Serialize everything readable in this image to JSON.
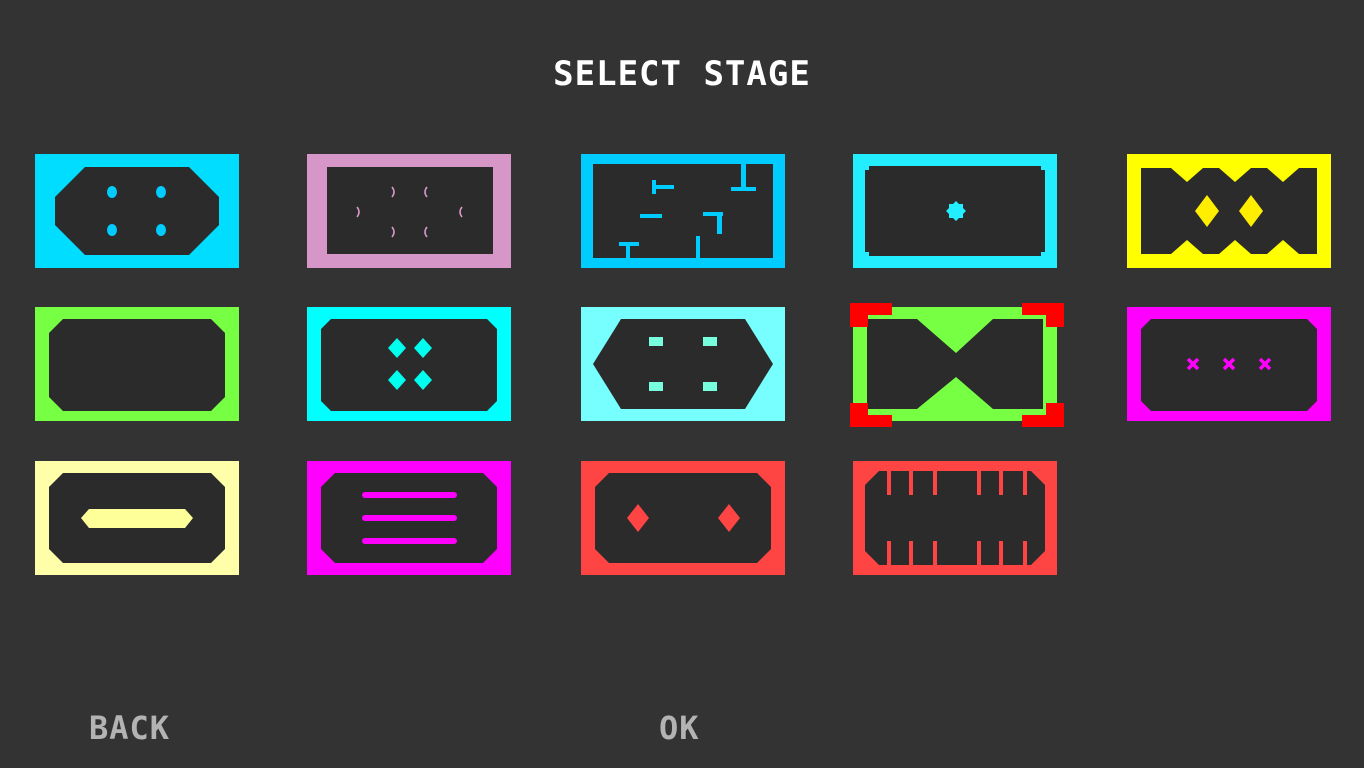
{
  "screen": {
    "title": "SELECT STAGE"
  },
  "buttons": {
    "back_label": "BACK",
    "ok_label": "OK"
  },
  "stages": [
    {
      "id": 1,
      "border_color": "#00ddff",
      "accent_color": "#00ccff",
      "pattern": "four-dots",
      "selected": false
    },
    {
      "id": 2,
      "border_color": "#d696c8",
      "accent_color": "#d696c8",
      "pattern": "crescents",
      "selected": false
    },
    {
      "id": 3,
      "border_color": "#00ccff",
      "accent_color": "#00ccff",
      "pattern": "maze-walls",
      "selected": false
    },
    {
      "id": 4,
      "border_color": "#22eeff",
      "accent_color": "#22eeff",
      "pattern": "center-star",
      "selected": false
    },
    {
      "id": 5,
      "border_color": "#ffff00",
      "accent_color": "#ffee00",
      "pattern": "zigzag-diamonds",
      "selected": false
    },
    {
      "id": 6,
      "border_color": "#77ff44",
      "accent_color": "#77ff44",
      "pattern": "empty",
      "selected": false
    },
    {
      "id": 7,
      "border_color": "#00ffff",
      "accent_color": "#00ffee",
      "pattern": "four-diamonds",
      "selected": false
    },
    {
      "id": 8,
      "border_color": "#77ffff",
      "accent_color": "#77ffdd",
      "pattern": "four-blocks",
      "selected": false
    },
    {
      "id": 9,
      "border_color": "#77ff44",
      "accent_color": "#77ff44",
      "pattern": "hourglass",
      "selected": true
    },
    {
      "id": 10,
      "border_color": "#ff00ff",
      "accent_color": "#ff00ff",
      "pattern": "three-crosses",
      "selected": false
    },
    {
      "id": 11,
      "border_color": "#ffffaa",
      "accent_color": "#ffff99",
      "pattern": "center-bar",
      "selected": false
    },
    {
      "id": 12,
      "border_color": "#ff00ff",
      "accent_color": "#ff00ff",
      "pattern": "three-lines",
      "selected": false
    },
    {
      "id": 13,
      "border_color": "#ff4444",
      "accent_color": "#ff4444",
      "pattern": "two-diamonds",
      "selected": false
    },
    {
      "id": 14,
      "border_color": "#ff4444",
      "accent_color": "#ff4444",
      "pattern": "comb-teeth",
      "selected": false
    }
  ],
  "selection": {
    "cursor_color": "#ff0000"
  }
}
